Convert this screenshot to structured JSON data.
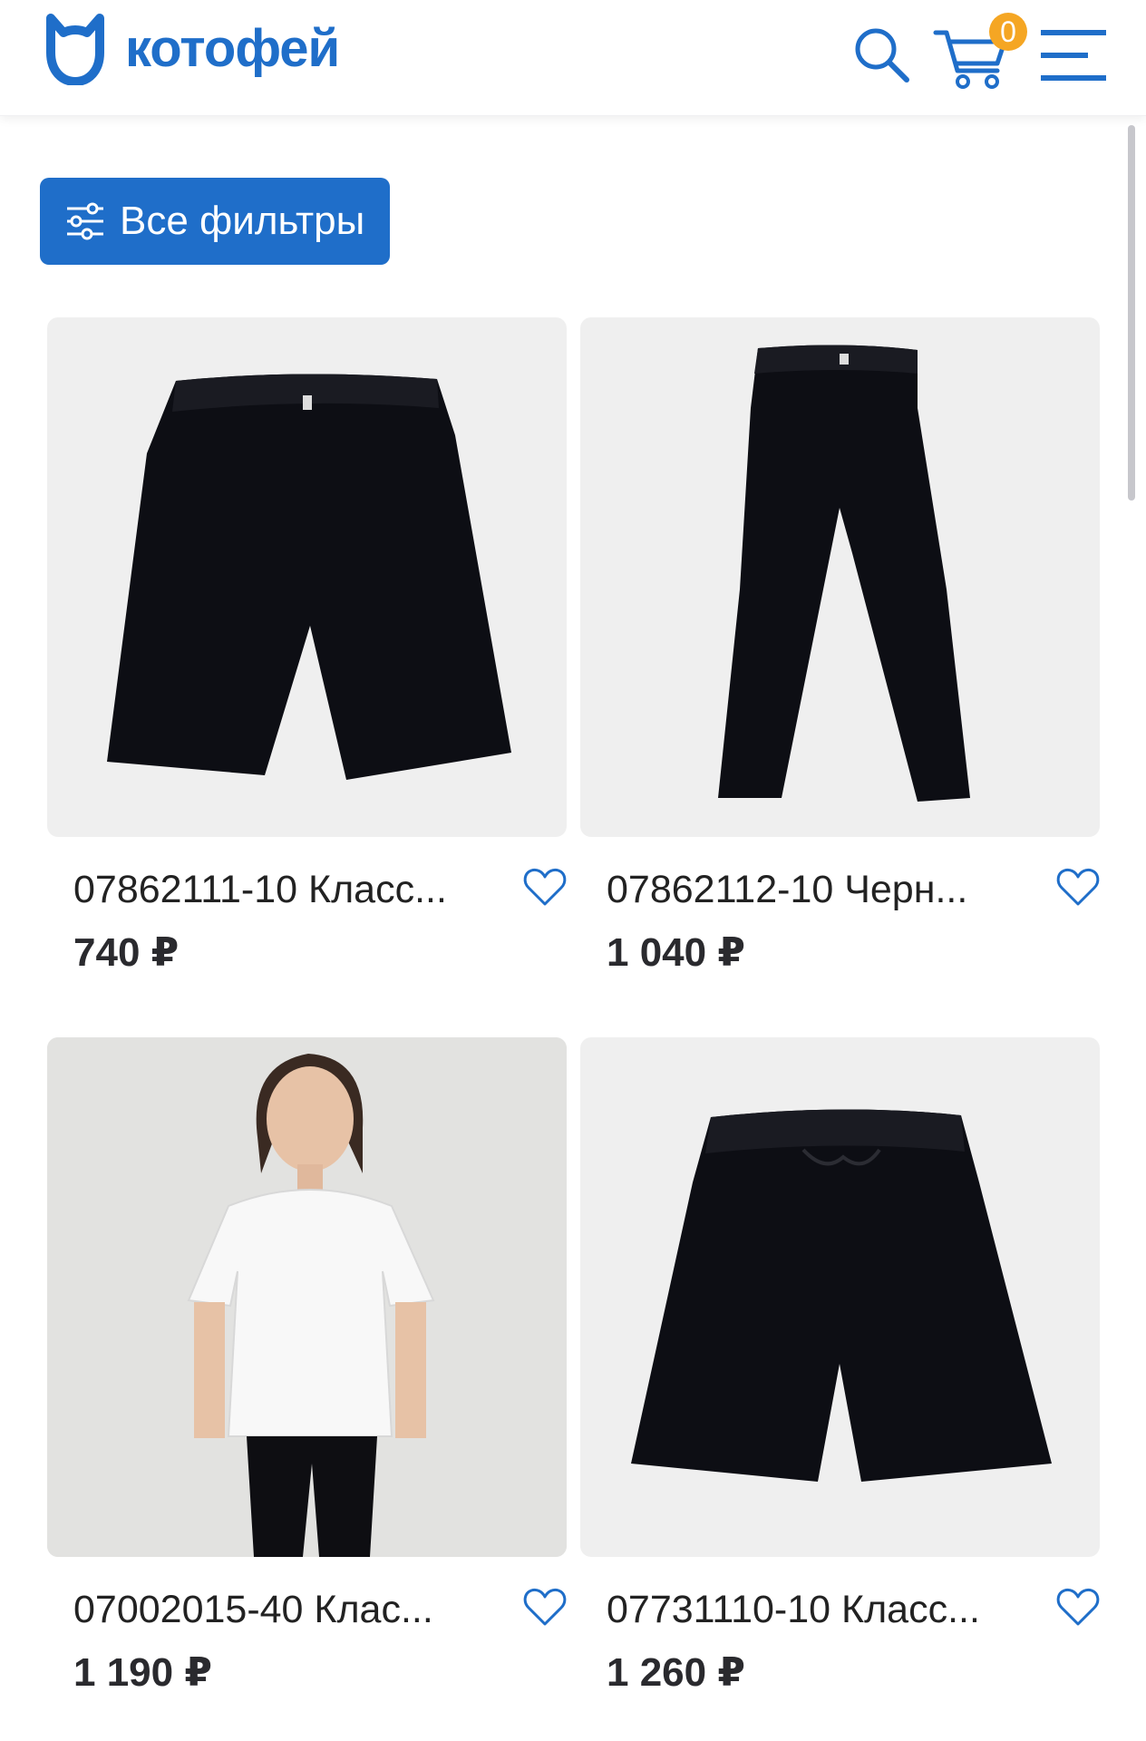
{
  "header": {
    "logo_text": "котофей",
    "cart_count": "0"
  },
  "filters": {
    "label": "Все фильтры"
  },
  "products": [
    {
      "title": "07862111-10 Класс...",
      "price": "740 ₽"
    },
    {
      "title": "07862112-10 Черн...",
      "price": "1 040 ₽"
    },
    {
      "title": "07002015-40 Клас...",
      "price": "1 190 ₽"
    },
    {
      "title": "07731110-10 Класс...",
      "price": "1 260 ₽"
    }
  ],
  "colors": {
    "brand_blue": "#1f6ec9",
    "badge_orange": "#f5a623",
    "image_bg": "#efefef"
  }
}
